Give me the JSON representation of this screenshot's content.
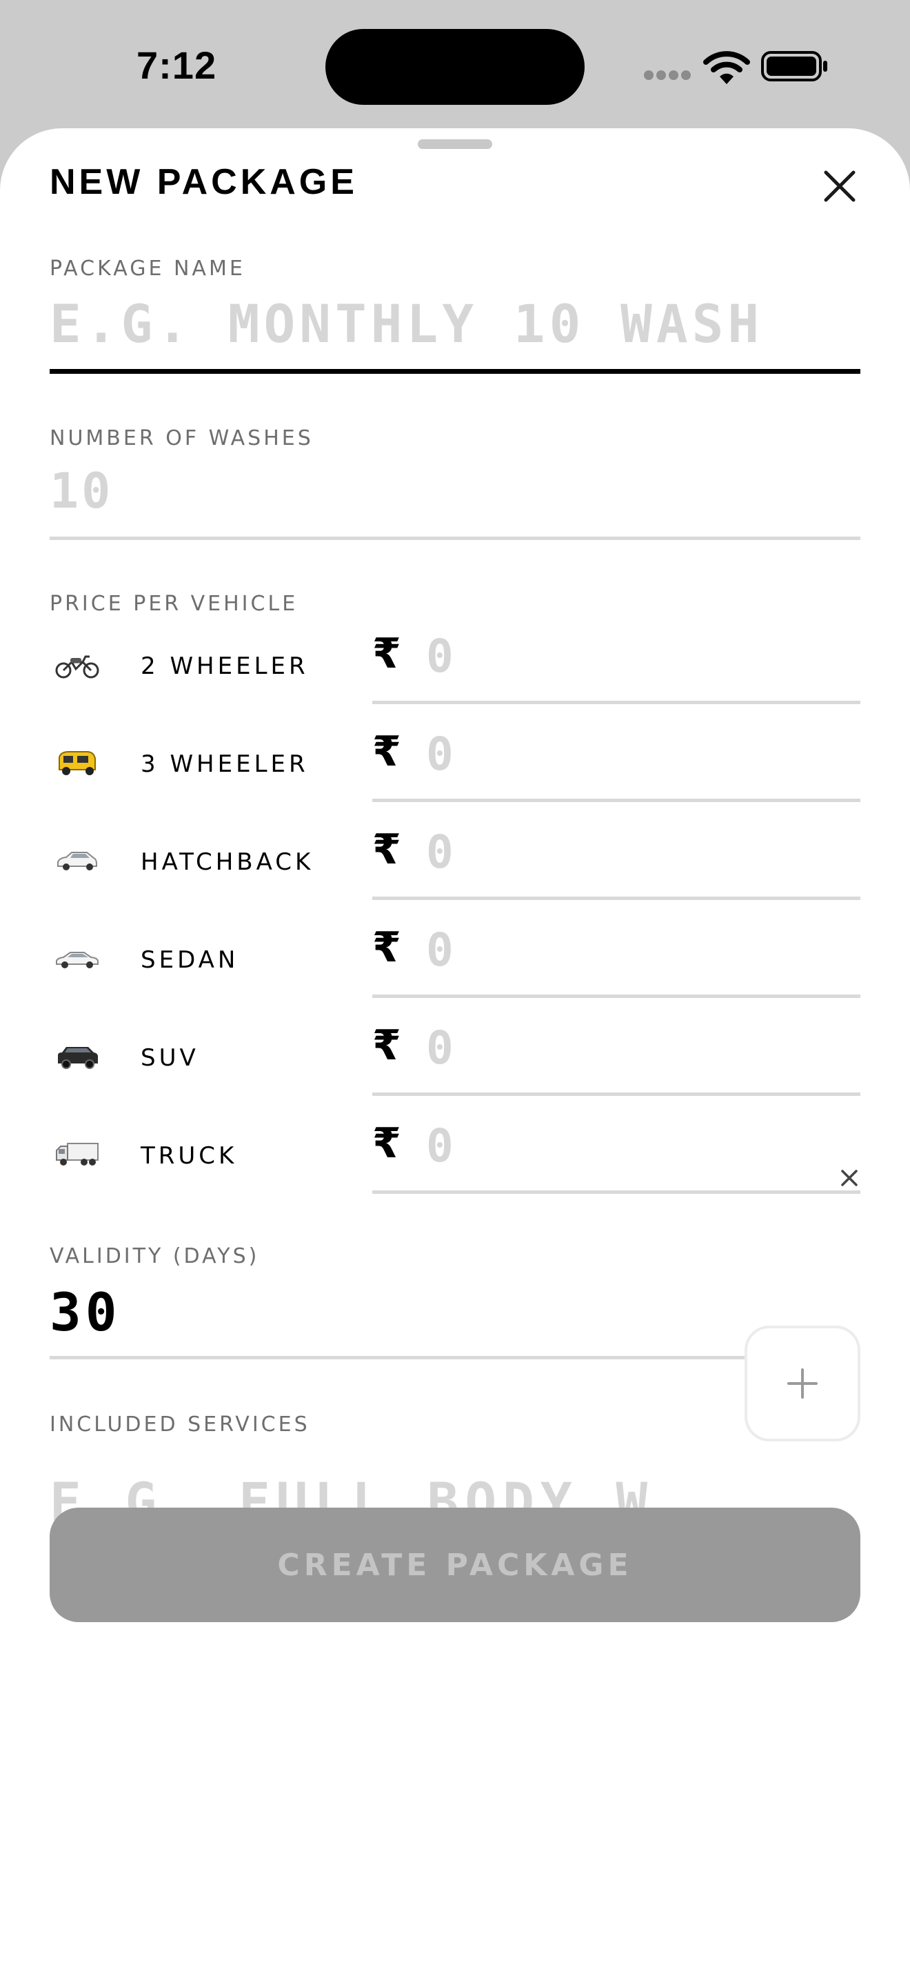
{
  "status_bar": {
    "time": "7:12"
  },
  "sheet": {
    "title": "NEW PACKAGE"
  },
  "form": {
    "package_name": {
      "label": "PACKAGE NAME",
      "placeholder": "E.G. MONTHLY 10 WASH",
      "value": ""
    },
    "number_of_washes": {
      "label": "NUMBER OF WASHES",
      "placeholder": "10",
      "value": ""
    },
    "price_per_vehicle": {
      "label": "PRICE PER VEHICLE",
      "currency_symbol": "₹",
      "vehicles": [
        {
          "name": "2 WHEELER",
          "icon": "motorcycle-icon",
          "placeholder": "0"
        },
        {
          "name": "3 WHEELER",
          "icon": "auto-rickshaw-icon",
          "placeholder": "0"
        },
        {
          "name": "HATCHBACK",
          "icon": "hatchback-icon",
          "placeholder": "0"
        },
        {
          "name": "SEDAN",
          "icon": "sedan-icon",
          "placeholder": "0"
        },
        {
          "name": "SUV",
          "icon": "suv-icon",
          "placeholder": "0"
        },
        {
          "name": "TRUCK",
          "icon": "truck-icon",
          "placeholder": "0"
        }
      ]
    },
    "validity": {
      "label": "VALIDITY (DAYS)",
      "value": "30"
    },
    "included_services": {
      "label": "INCLUDED SERVICES",
      "placeholder": "E.G. FULL BODY W…"
    },
    "submit_label": "CREATE PACKAGE"
  },
  "colors": {
    "accent_text": "#000000",
    "placeholder": "#d6d6d6",
    "disabled_button": "#999999",
    "rickshaw_yellow": "#f2c21b"
  }
}
